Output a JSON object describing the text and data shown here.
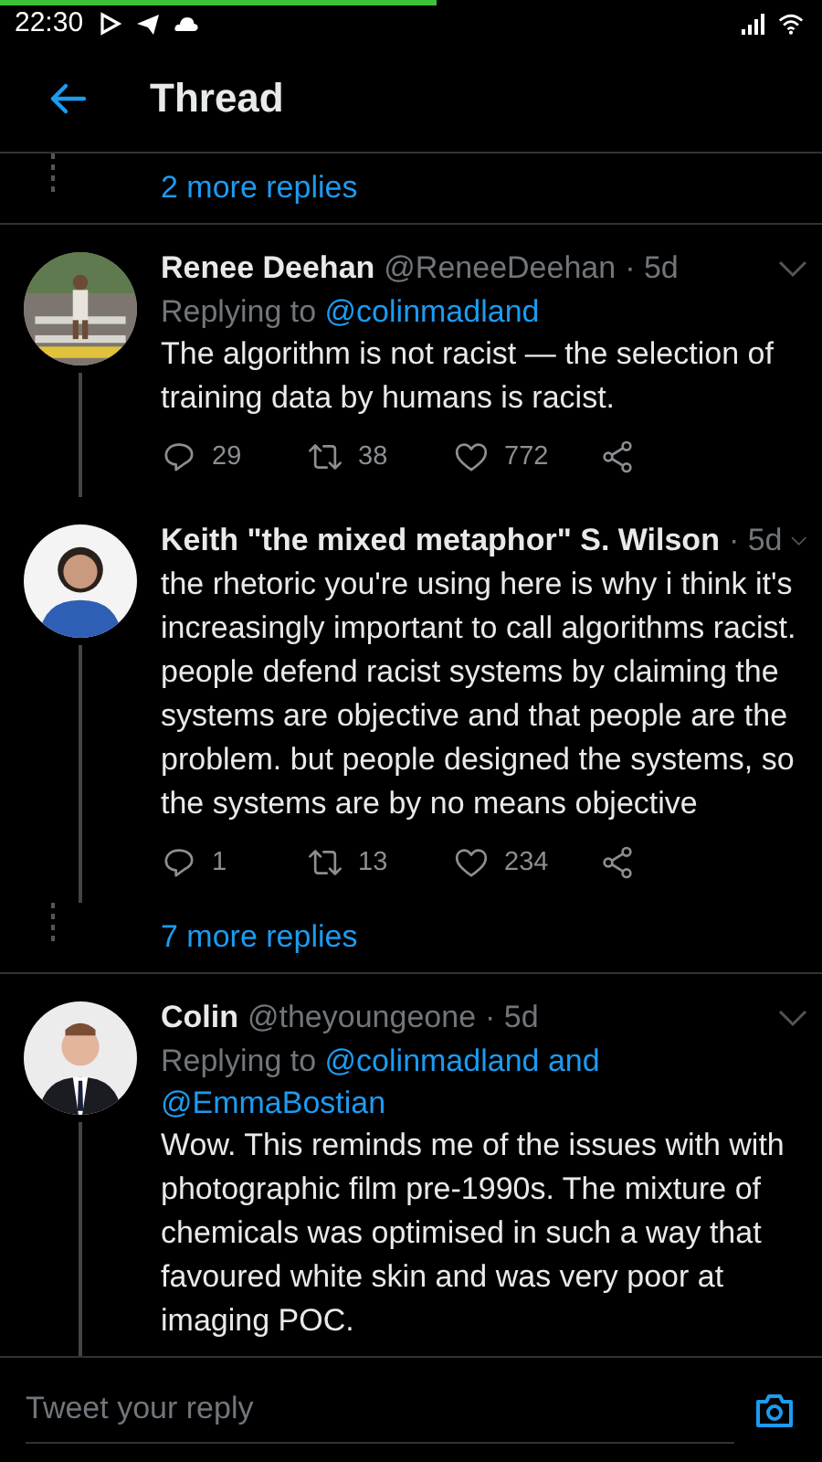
{
  "status_bar": {
    "time": "22:30"
  },
  "header": {
    "title": "Thread"
  },
  "thread": [
    {
      "kind": "more_replies",
      "label": "2 more replies"
    },
    {
      "kind": "tweet",
      "name": "Renee Deehan",
      "handle": "@ReneeDeehan",
      "time": "· 5d",
      "replying": {
        "label": "Replying to",
        "mentions": [
          "@colinmadland"
        ]
      },
      "text": "The algorithm is not racist — the selection of training data by humans is racist.",
      "replies": "29",
      "retweets": "38",
      "likes": "772",
      "connector": true
    },
    {
      "kind": "tweet",
      "name": "Keith \"the mixed metaphor\" S. Wilson",
      "time": "· 5d",
      "text": "the rhetoric you're using here is why i think it's increasingly important to call algorithms racist. people defend racist systems by claiming the systems are objective and that people are the problem. but people designed the systems, so the systems are by no means objective",
      "replies": "1",
      "retweets": "13",
      "likes": "234",
      "connector": true
    },
    {
      "kind": "more_replies",
      "label": "7 more replies"
    },
    {
      "kind": "tweet",
      "name": "Colin",
      "handle": "@theyoungeone",
      "time": "· 5d",
      "replying": {
        "label": "Replying to",
        "mentions": [
          "@colinmadland and",
          "@EmmaBostian"
        ]
      },
      "text": "Wow. This reminds me of the issues with with photographic film pre-1990s. The mixture of chemicals was optimised in such a way that favoured white skin and was very poor at imaging POC.",
      "connector": true
    }
  ],
  "reply_bar": {
    "placeholder": "Tweet your reply"
  }
}
